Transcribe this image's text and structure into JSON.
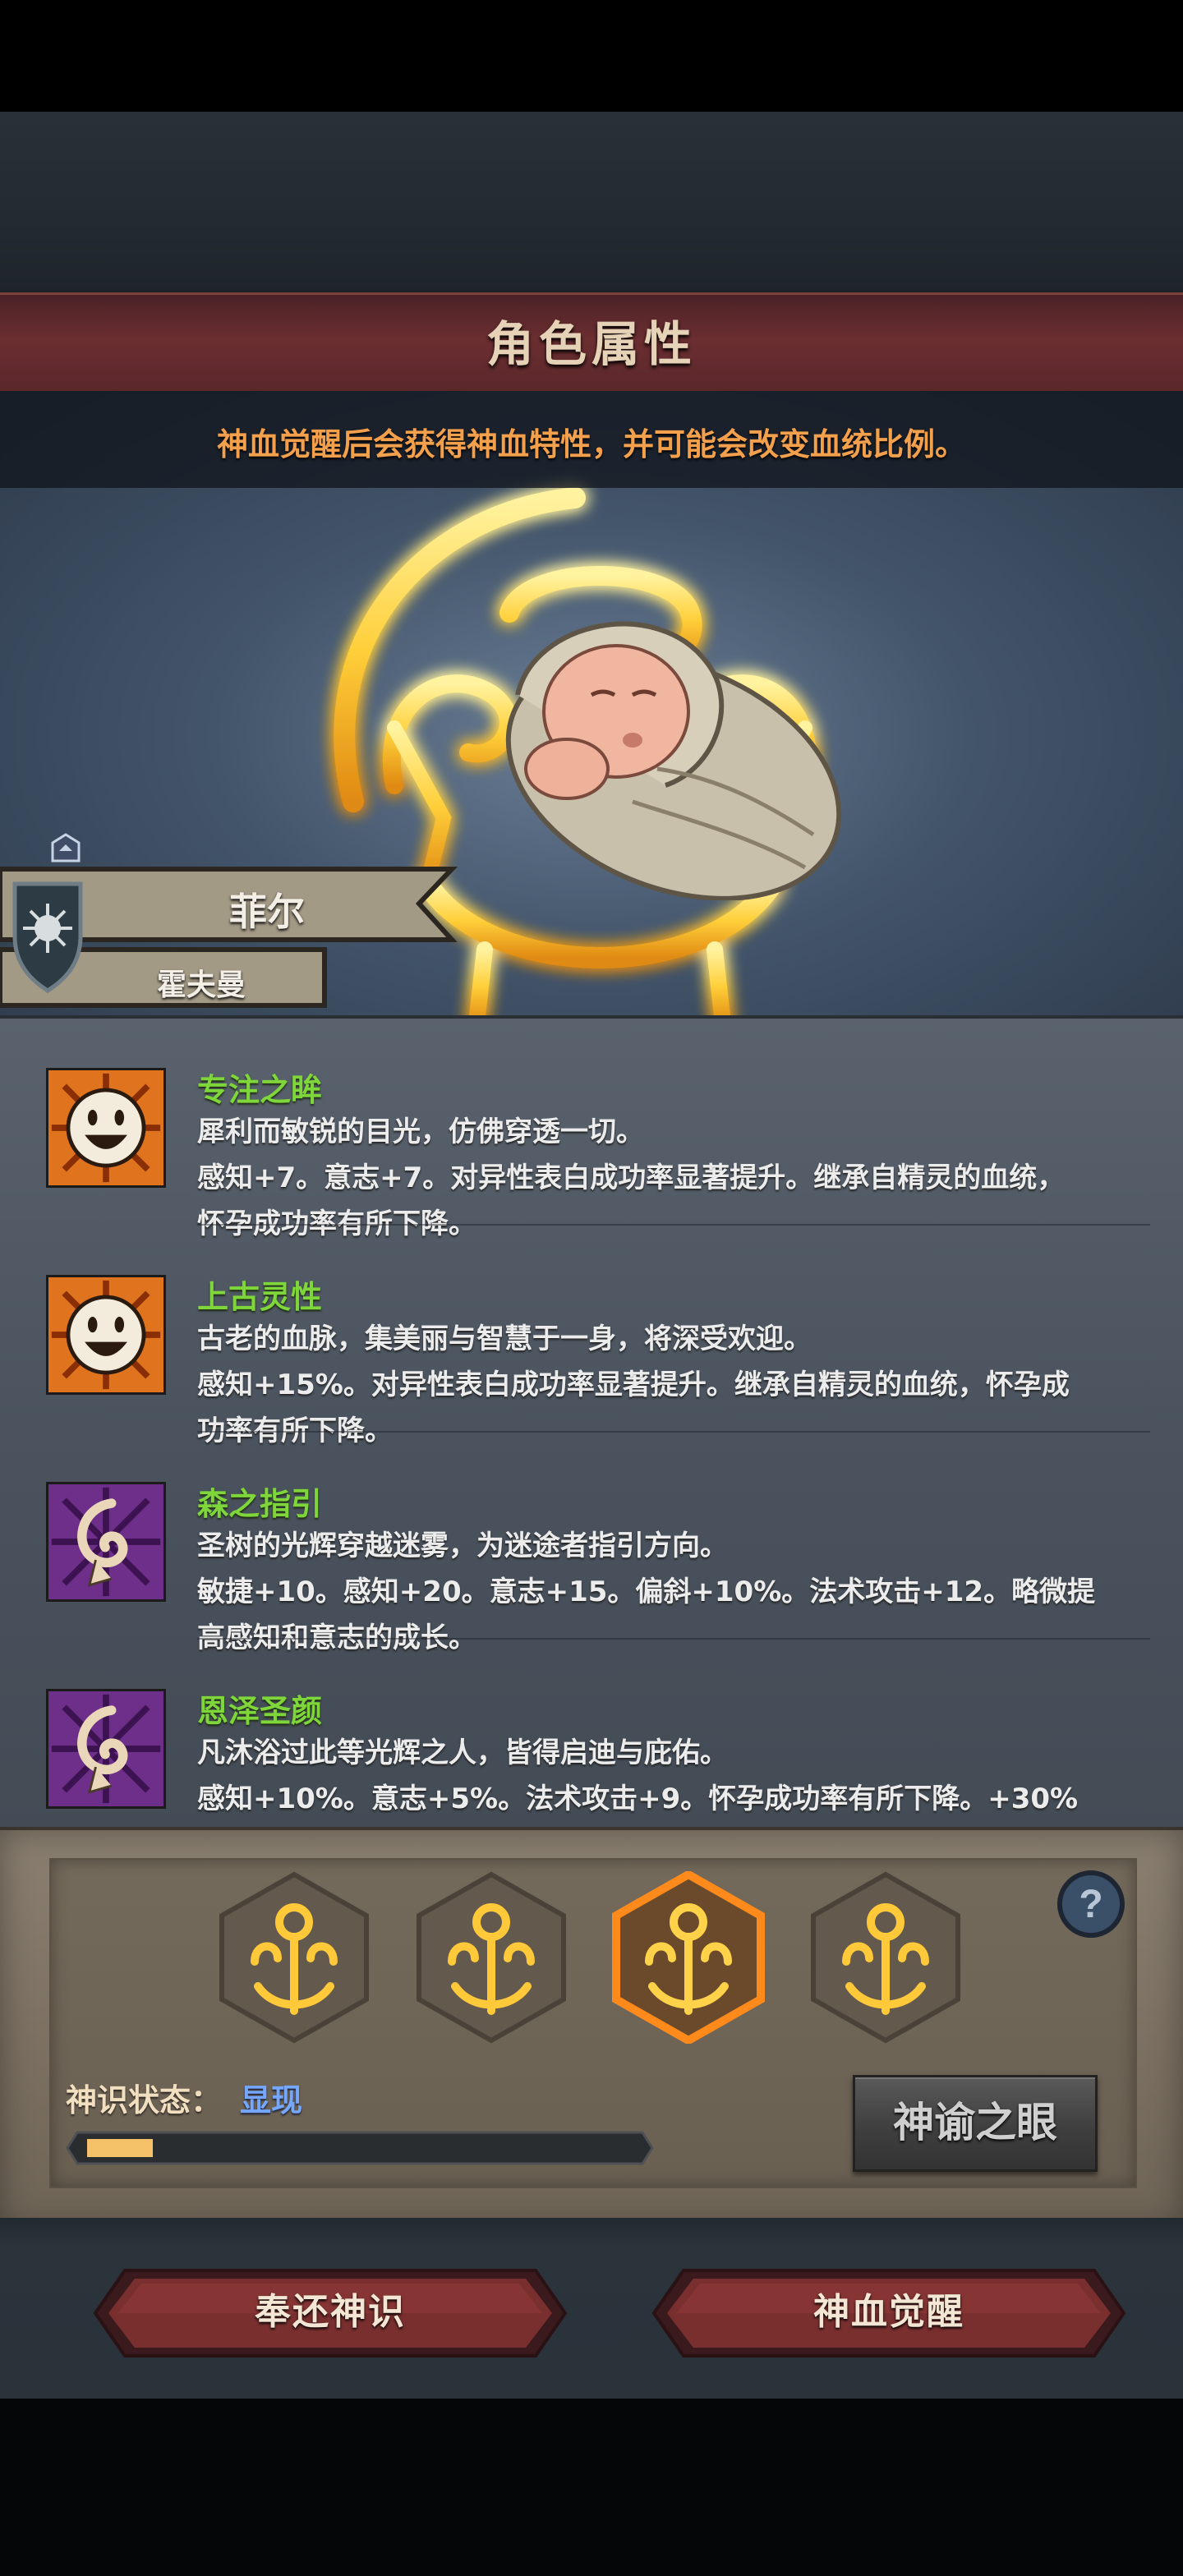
{
  "title": "角色属性",
  "hint": "神血觉醒后会获得神血特性，并可能会改变血统比例。",
  "character": {
    "name": "菲尔",
    "surname": "霍夫曼"
  },
  "traits": [
    {
      "name": "专注之眸",
      "icon": "smiley-face-icon",
      "desc_lines": [
        "犀利而敏锐的目光，仿佛穿透一切。",
        "感知+7。意志+7。对异性表白成功率显著提升。继承自精灵的血统，",
        "怀孕成功率有所下降。"
      ]
    },
    {
      "name": "上古灵性",
      "icon": "smiley-face-icon",
      "desc_lines": [
        "古老的血脉，集美丽与智慧于一身，将深受欢迎。",
        "感知+15%。对异性表白成功率显著提升。继承自精灵的血统，怀孕成",
        "功率有所下降。"
      ]
    },
    {
      "name": "森之指引",
      "icon": "spiral-swirl-icon",
      "desc_lines": [
        "圣树的光辉穿越迷雾，为迷途者指引方向。",
        "敏捷+10。感知+20。意志+15。偏斜+10%。法术攻击+12。略微提",
        "高感知和意志的成长。"
      ]
    },
    {
      "name": "恩泽圣颜",
      "icon": "spiral-swirl-icon",
      "desc_lines": [
        "凡沐浴过此等光辉之人，皆得启迪与庇佑。",
        "感知+10%。意志+5%。法术攻击+9。怀孕成功率有所下降。+30%",
        ""
      ]
    }
  ],
  "divine_slots": [
    {
      "icon": "divine-crest-icon",
      "selected": false
    },
    {
      "icon": "divine-crest-icon",
      "selected": false
    },
    {
      "icon": "divine-crest-icon",
      "selected": true
    },
    {
      "icon": "divine-crest-icon",
      "selected": false
    }
  ],
  "status": {
    "label": "神识状态：",
    "value": "显现",
    "progress": 0.12
  },
  "oracle_button": "神谕之眼",
  "help_icon": "question-mark-icon",
  "buttons": {
    "return": "奉还神识",
    "awaken": "神血觉醒"
  },
  "colors": {
    "trait_name": "#7fd63a",
    "hint": "#f3a04c",
    "status_value": "#76a7ff",
    "progress_fill": "#f5c26a",
    "selected_glow": "#ff8a1c",
    "emblem_gold": "#ffcf3a"
  }
}
